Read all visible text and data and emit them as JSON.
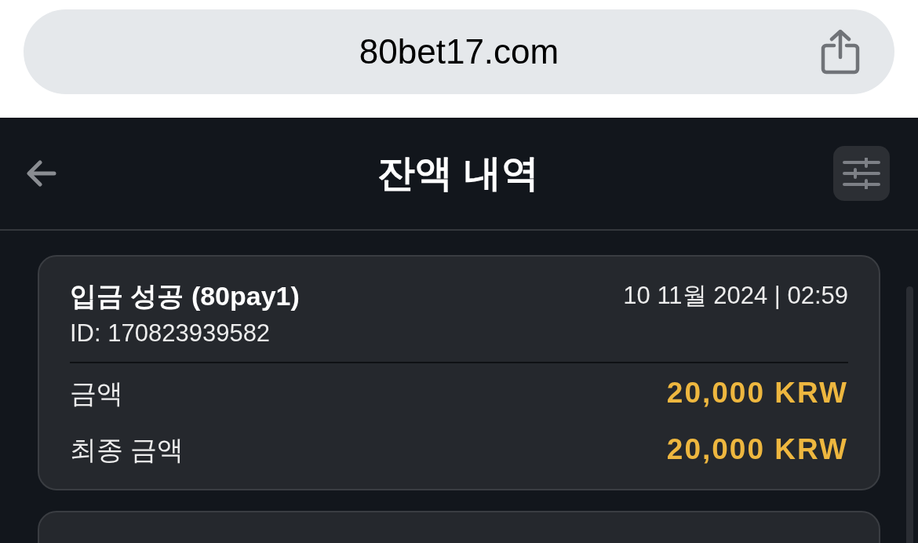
{
  "browser": {
    "url": "80bet17.com"
  },
  "header": {
    "title": "잔액 내역"
  },
  "transactions": [
    {
      "title": "입금 성공 (80pay1)",
      "datetime": "10 11월 2024 | 02:59",
      "id": "ID: 170823939582",
      "rows": [
        {
          "label": "금액",
          "value": "20,000 KRW"
        },
        {
          "label": "최종 금액",
          "value": "20,000 KRW"
        }
      ]
    }
  ]
}
